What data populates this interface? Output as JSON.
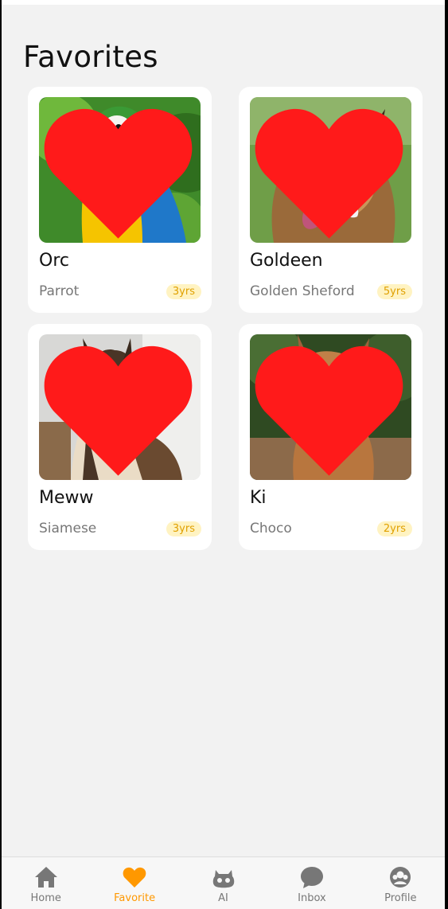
{
  "page": {
    "title": "Favorites"
  },
  "colors": {
    "accent": "#ff9800",
    "heart": "#ff1a1a",
    "badge_bg": "#fff3c2",
    "badge_text": "#e0a000",
    "nav_inactive": "#777777"
  },
  "pets": [
    {
      "name": "Orc",
      "breed": "Parrot",
      "age": "3yrs",
      "favorite": true,
      "photo": "macaw-parrot"
    },
    {
      "name": "Goldeen",
      "breed": "Golden Sheford",
      "age": "5yrs",
      "favorite": true,
      "photo": "dog-tongue-out"
    },
    {
      "name": "Meww",
      "breed": "Siamese",
      "age": "3yrs",
      "favorite": true,
      "photo": "siamese-cat"
    },
    {
      "name": "Ki",
      "breed": "Choco",
      "age": "2yrs",
      "favorite": true,
      "photo": "brown-dog-red-collar"
    }
  ],
  "nav": {
    "items": [
      {
        "label": "Home",
        "icon": "home-icon",
        "active": false
      },
      {
        "label": "Favorite",
        "icon": "heart-icon",
        "active": true
      },
      {
        "label": "AI",
        "icon": "robot-icon",
        "active": false
      },
      {
        "label": "Inbox",
        "icon": "chat-bubble-icon",
        "active": false
      },
      {
        "label": "Profile",
        "icon": "profile-icon",
        "active": false
      }
    ]
  }
}
